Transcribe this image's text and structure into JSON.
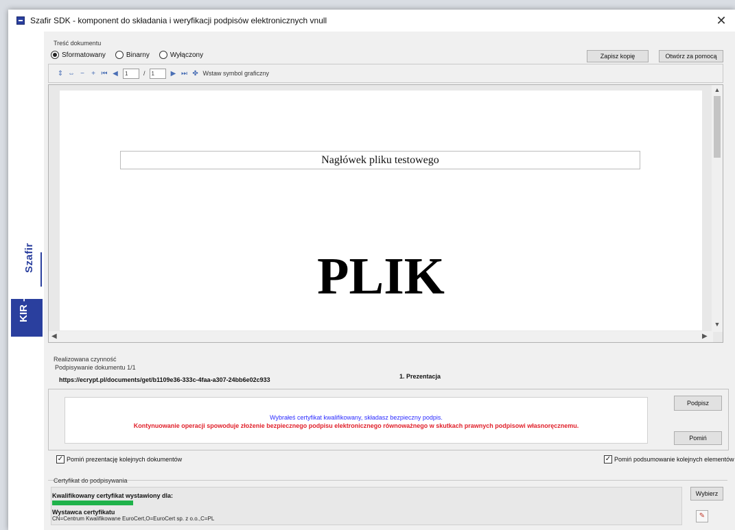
{
  "window": {
    "title": "Szafir SDK - komponent do składania i weryfikacji podpisów elektronicznych vnull",
    "close_glyph": "✕"
  },
  "brand": {
    "name": "Szafir",
    "owner": "KIR"
  },
  "document": {
    "group_label": "Treść dokumentu",
    "modes": [
      {
        "label": "Sformatowany",
        "checked": true
      },
      {
        "label": "Binarny",
        "checked": false
      },
      {
        "label": "Wyłączony",
        "checked": false
      }
    ],
    "save_copy_label": "Zapisz kopię",
    "open_with_label": "Otwórz za pomocą"
  },
  "toolbar": {
    "page_current": "1",
    "page_total": "1",
    "insert_symbol_label": "Wstaw symbol graficzny",
    "icons": [
      "fit-height-icon",
      "fit-width-icon",
      "zoom-out-icon",
      "zoom-in-icon",
      "first-page-icon",
      "prev-page-icon",
      "next-page-icon",
      "last-page-icon",
      "insert-symbol-icon"
    ]
  },
  "preview": {
    "header_text": "Nagłówek pliku testowego",
    "body_text": "PLIK"
  },
  "activity": {
    "label": "Realizowana czynność",
    "progress": "Podpisywanie dokumentu 1/1",
    "url": "https://ecrypt.pl/documents/get/b1109e36-333c-4faa-a307-24bb6e02c933",
    "step": "1. Prezentacja"
  },
  "sign_panel": {
    "info": "Wybrałeś certyfikat kwalifikowany, składasz bezpieczny podpis.",
    "warning": "Kontynuowanie operacji spowoduje złożenie bezpiecznego podpisu elektronicznego równoważnego w skutkach prawnych podpisowi własnoręcznemu.",
    "sign_label": "Podpisz",
    "skip_label": "Pomiń"
  },
  "options": {
    "skip_presentation": "Pomiń prezentację kolejnych dokumentów",
    "skip_summary": "Pomiń podsumowanie kolejnych elementów",
    "check_glyph": "✓"
  },
  "certificate": {
    "group_label": "Certyfikat do podpisywania",
    "title": "Kwalifikowany certyfikat wystawiony dla:",
    "issuer_label": "Wystawca certyfikatu",
    "issuer_value": "CN=Centrum Kwalifikowane EuroCert,O=EuroCert sp. z o.o.,C=PL",
    "choose_label": "Wybierz",
    "redaction_color": "#1fb24a"
  },
  "colors": {
    "brand": "#2a3f9e",
    "info": "#2b2bff",
    "warning": "#e0202a"
  }
}
